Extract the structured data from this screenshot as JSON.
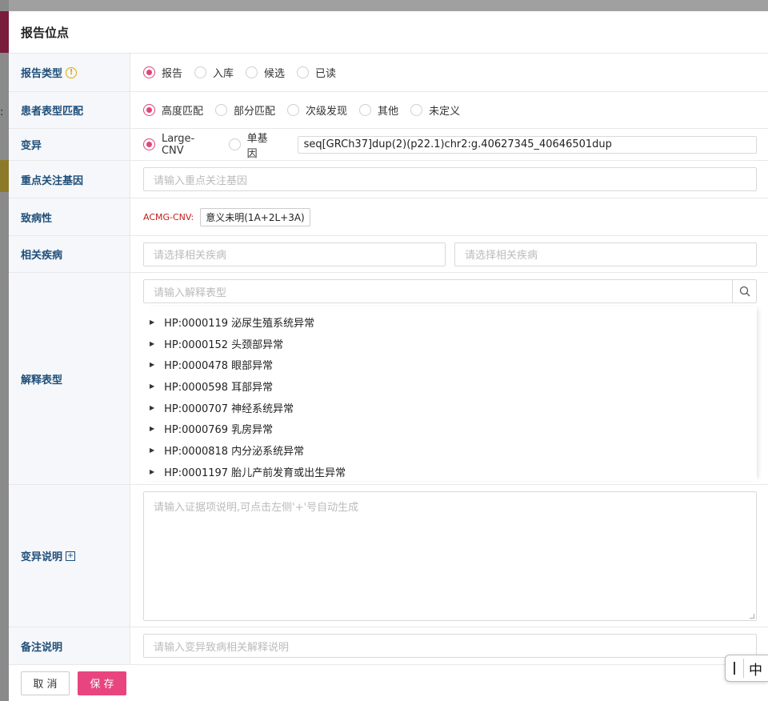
{
  "modal": {
    "title": "报告位点"
  },
  "fields": {
    "report_type": {
      "label": "报告类型",
      "options": [
        "报告",
        "入库",
        "候选",
        "已读"
      ],
      "selected": "报告"
    },
    "phenotype_match": {
      "label": "患者表型匹配",
      "options": [
        "高度匹配",
        "部分匹配",
        "次级发现",
        "其他",
        "未定义"
      ],
      "selected": "高度匹配"
    },
    "variant": {
      "label": "变异",
      "options": [
        "Large-CNV",
        "单基因"
      ],
      "selected": "Large-CNV",
      "value": "seq[GRCh37]dup(2)(p22.1)chr2:g.40627345_40646501dup"
    },
    "focus_gene": {
      "label": "重点关注基因",
      "placeholder": "请输入重点关注基因"
    },
    "pathogenicity": {
      "label": "致病性",
      "acmg_label": "ACMG-CNV:",
      "acmg_value": "意义未明(1A+2L+3A)"
    },
    "related_disease": {
      "label": "相关疾病",
      "placeholder_1": "请选择相关疾病",
      "placeholder_2": "请选择相关疾病"
    },
    "phenotype": {
      "label": "解释表型",
      "search_placeholder": "请输入解释表型",
      "items": [
        "HP:0000119 泌尿生殖系统异常",
        "HP:0000152 头颈部异常",
        "HP:0000478 眼部异常",
        "HP:0000598 耳部异常",
        "HP:0000707 神经系统异常",
        "HP:0000769 乳房异常",
        "HP:0000818 内分泌系统异常",
        "HP:0001197 胎儿产前发育或出生异常"
      ]
    },
    "variant_note": {
      "label": "变异说明",
      "placeholder": "请输入证据项说明,可点击左侧'+'号自动生成"
    },
    "remark": {
      "label": "备注说明",
      "placeholder": "请输入变异致病相关解释说明"
    }
  },
  "footer": {
    "cancel_label": "取 消",
    "save_label": "保 存"
  },
  "ime": {
    "mode": "中"
  },
  "colors": {
    "accent": "#e8457f",
    "label_text": "#1f4e79",
    "warning": "#e0a800",
    "acmg_red": "#c21c1c"
  }
}
